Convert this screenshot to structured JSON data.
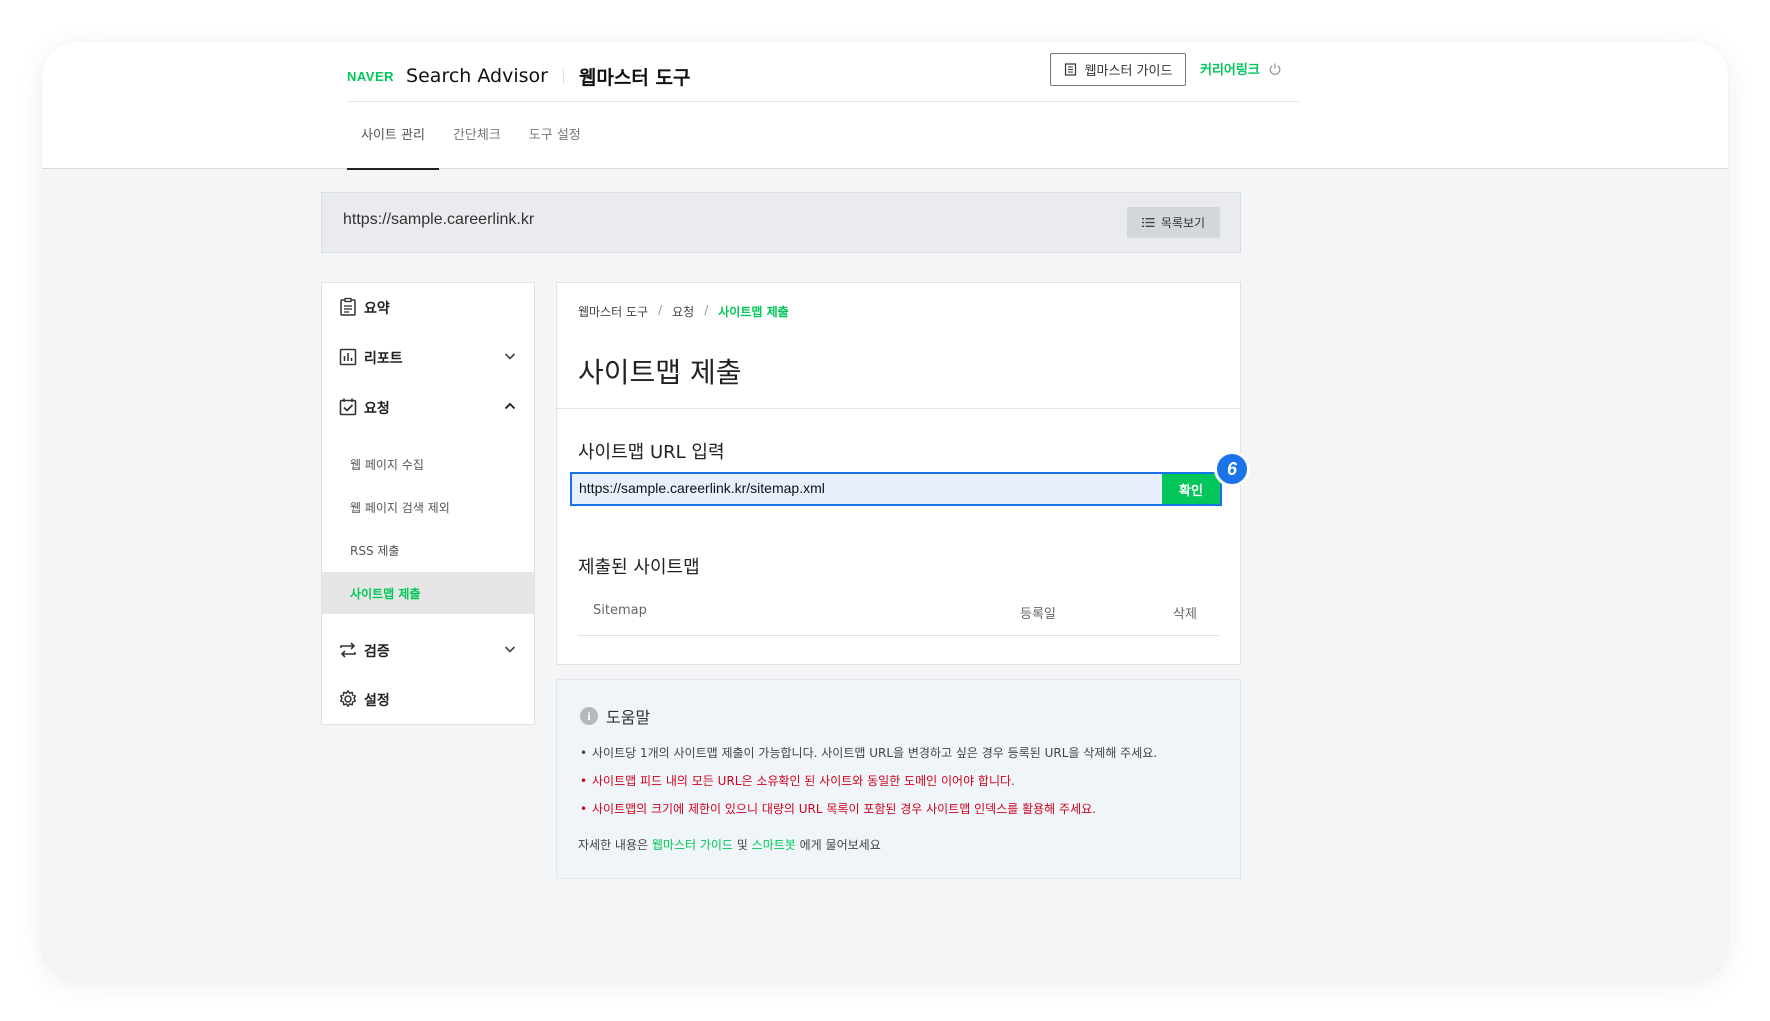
{
  "header": {
    "naver_logo": "NAVER",
    "product": "Search Advisor",
    "tool_title": "웹마스터 도구",
    "guide_button": "웹마스터 가이드",
    "user_name": "커리어링크",
    "icons": {
      "guide": "document-icon",
      "logout": "power-icon"
    }
  },
  "tabs": [
    {
      "label": "사이트 관리",
      "active": true
    },
    {
      "label": "간단체크",
      "active": false
    },
    {
      "label": "도구 설정",
      "active": false
    }
  ],
  "site_bar": {
    "url": "https://sample.careerlink.kr",
    "list_button": "목록보기"
  },
  "sidebar": {
    "items": [
      {
        "label": "요약",
        "icon": "clipboard-icon"
      },
      {
        "label": "리포트",
        "icon": "bar-chart-icon",
        "expanded": false
      },
      {
        "label": "요청",
        "icon": "checkbox-icon",
        "expanded": true
      },
      {
        "label": "검증",
        "icon": "repeat-icon",
        "expanded": false
      },
      {
        "label": "설정",
        "icon": "gear-icon"
      }
    ],
    "sub_items": [
      {
        "label": "웹 페이지 수집"
      },
      {
        "label": "웹 페이지 검색 제외"
      },
      {
        "label": "RSS 제출"
      },
      {
        "label": "사이트맵 제출",
        "active": true
      }
    ]
  },
  "main": {
    "breadcrumb": [
      "웹마스터 도구",
      "요청",
      "사이트맵 제출"
    ],
    "title": "사이트맵 제출",
    "input_section": "사이트맵 URL 입력",
    "input_value": "https://sample.careerlink.kr/sitemap.xml",
    "confirm_button": "확인",
    "step_number": "6",
    "submitted_section": "제출된 사이트맵",
    "table_headers": [
      "Sitemap",
      "등록일",
      "삭제"
    ]
  },
  "help": {
    "title": "도움말",
    "items": [
      {
        "text": "사이트당 1개의 사이트맵 제출이 가능합니다. 사이트맵 URL을 변경하고 싶은 경우 등록된 URL을 삭제해 주세요.",
        "color": "#444444"
      },
      {
        "text": "사이트맵 피드 내의 모든 URL은 소유확인 된 사이트와 동일한 도메인 이어야 합니다.",
        "color": "#d0021b"
      },
      {
        "text": "사이트맵의 크기에 제한이 있으니 대량의 URL 목록이 포함된 경우 사이트맵 인덱스를 활용해 주세요.",
        "color": "#d0021b"
      }
    ],
    "more_prefix": "자세한 내용은 ",
    "more_link1": "웹마스터 가이드",
    "more_mid": " 및 ",
    "more_link2": "스마트봇",
    "more_suffix": " 에게 물어보세요"
  },
  "colors": {
    "brand": "#03c75a",
    "accent_blue": "#1a73e8",
    "warning": "#d0021b"
  }
}
